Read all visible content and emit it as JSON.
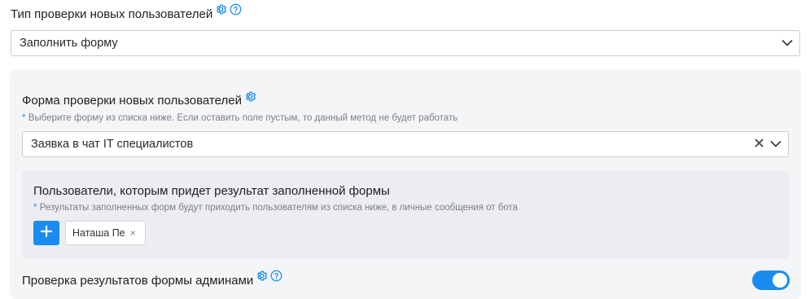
{
  "verification": {
    "title": "Тип проверки новых пользователей",
    "selected": "Заполнить форму"
  },
  "form_section": {
    "title": "Форма проверки новых пользователей",
    "hint_star": "*",
    "hint": "Выберите форму из списка ниже. Если оставить поле пустым, то данный метод не будет работать",
    "selected": "Заявка в чат IT специалистов"
  },
  "recipients": {
    "title": "Пользователи, которым придет результат заполненной формы",
    "hint_star": "*",
    "hint": "Результаты заполненных форм будут приходить пользователям из списка ниже, в личные сообщения от бота",
    "add_label": "+",
    "users": [
      "Наташа Пе"
    ],
    "remove_glyph": "×"
  },
  "admin_check": {
    "title": "Проверка результатов формы админами",
    "enabled": true
  },
  "icons": {
    "settings": "gear-icon",
    "help": "help-circle-icon",
    "dropdown": "chevron-down-icon",
    "clear": "clear-x-icon",
    "add": "plus-icon"
  },
  "colors": {
    "accent": "#1a8cf0",
    "panel": "#f4f5f7",
    "subpanel": "#ecedf0",
    "hint_text": "#7a7f87"
  }
}
